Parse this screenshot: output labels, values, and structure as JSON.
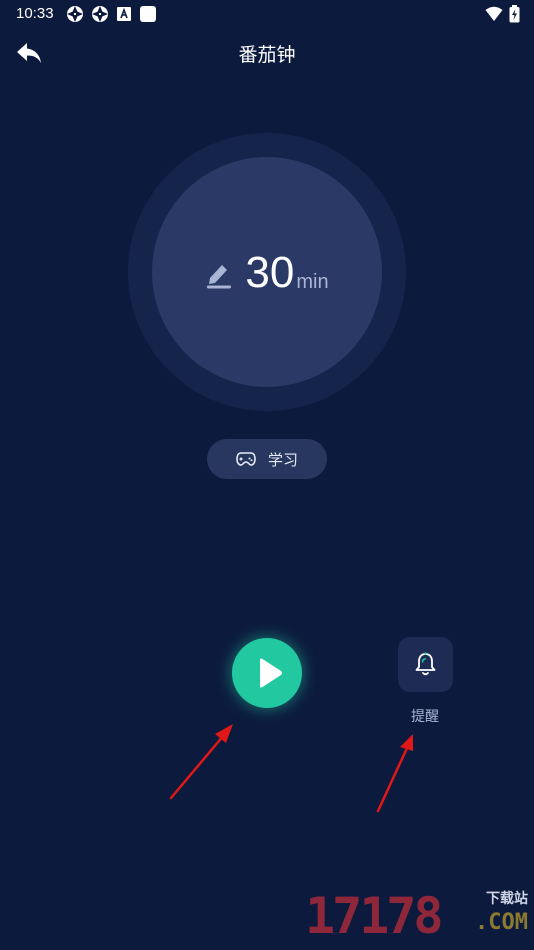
{
  "status_bar": {
    "time": "10:33",
    "left_icons": [
      "aperture-icon",
      "aperture-icon",
      "font-a-icon",
      "white-square-icon"
    ],
    "right_icons": [
      "wifi-icon",
      "battery-charging-icon"
    ]
  },
  "header": {
    "title": "番茄钟",
    "back_icon": "back-arrow-icon"
  },
  "timer": {
    "value": "30",
    "unit": "min",
    "edit_icon": "pencil-icon"
  },
  "category": {
    "label": "学习",
    "icon": "gamepad-icon"
  },
  "controls": {
    "play_icon": "play-icon",
    "reminder_label": "提醒",
    "reminder_icon": "bell-icon"
  },
  "watermark": {
    "digits": "17178",
    "site_text": "下载站",
    "domain_text": ".COM"
  },
  "colors": {
    "background": "#0c1a3d",
    "timer_outer": "#15244a",
    "timer_inner": "#2a3965",
    "accent_green": "#22c9a0",
    "annotation_red": "#e01818"
  }
}
